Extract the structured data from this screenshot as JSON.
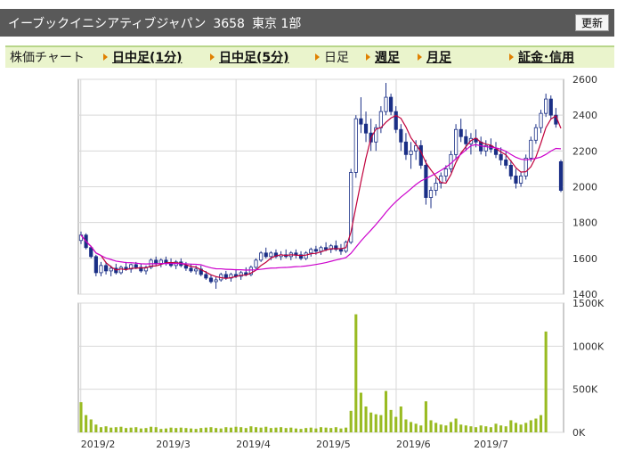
{
  "header": {
    "title": "イーブックイニシアティブジャパン",
    "code": "3658",
    "market": "東京 1部",
    "refresh_label": "更新"
  },
  "nav": {
    "chart_label": "株価チャート",
    "intraday_1": "日中足(1分)",
    "intraday_5": "日中足(5分)",
    "daily": "日足",
    "weekly": "週足",
    "monthly": "月足",
    "margin": "証金･信用"
  },
  "colors": {
    "up": "#ffffff",
    "down": "#1a2f86",
    "ma_short": "#c0003c",
    "ma_long": "#cc00cc",
    "volume": "#99bb22",
    "profile": "#999999"
  },
  "chart_data": [
    {
      "type": "candlestick",
      "y_ticks": [
        2600,
        2400,
        2200,
        2000,
        1800,
        1600,
        1400
      ],
      "ylim": [
        1400,
        2600
      ],
      "x_ticks": [
        "2019/2",
        "2019/3",
        "2019/4",
        "2019/5",
        "2019/6",
        "2019/7"
      ],
      "ohlc": [
        [
          1700,
          1750,
          1680,
          1730
        ],
        [
          1730,
          1740,
          1650,
          1660
        ],
        [
          1660,
          1670,
          1600,
          1610
        ],
        [
          1610,
          1620,
          1500,
          1520
        ],
        [
          1520,
          1580,
          1500,
          1560
        ],
        [
          1560,
          1580,
          1510,
          1530
        ],
        [
          1530,
          1560,
          1500,
          1545
        ],
        [
          1545,
          1570,
          1510,
          1520
        ],
        [
          1520,
          1560,
          1510,
          1550
        ],
        [
          1550,
          1580,
          1530,
          1540
        ],
        [
          1540,
          1570,
          1520,
          1565
        ],
        [
          1565,
          1580,
          1540,
          1550
        ],
        [
          1550,
          1570,
          1520,
          1530
        ],
        [
          1530,
          1560,
          1510,
          1550
        ],
        [
          1550,
          1600,
          1540,
          1590
        ],
        [
          1590,
          1610,
          1560,
          1570
        ],
        [
          1570,
          1600,
          1550,
          1590
        ],
        [
          1590,
          1610,
          1560,
          1575
        ],
        [
          1575,
          1600,
          1550,
          1560
        ],
        [
          1560,
          1590,
          1540,
          1580
        ],
        [
          1580,
          1600,
          1550,
          1560
        ],
        [
          1560,
          1580,
          1530,
          1545
        ],
        [
          1545,
          1570,
          1520,
          1530
        ],
        [
          1530,
          1560,
          1510,
          1540
        ],
        [
          1540,
          1560,
          1500,
          1510
        ],
        [
          1510,
          1530,
          1480,
          1490
        ],
        [
          1490,
          1510,
          1460,
          1470
        ],
        [
          1470,
          1500,
          1430,
          1480
        ],
        [
          1480,
          1520,
          1470,
          1510
        ],
        [
          1510,
          1530,
          1480,
          1490
        ],
        [
          1490,
          1520,
          1470,
          1510
        ],
        [
          1510,
          1540,
          1490,
          1500
        ],
        [
          1500,
          1530,
          1480,
          1520
        ],
        [
          1520,
          1550,
          1500,
          1510
        ],
        [
          1510,
          1560,
          1500,
          1550
        ],
        [
          1550,
          1600,
          1540,
          1590
        ],
        [
          1590,
          1640,
          1580,
          1630
        ],
        [
          1630,
          1660,
          1600,
          1610
        ],
        [
          1610,
          1640,
          1590,
          1630
        ],
        [
          1630,
          1650,
          1600,
          1610
        ],
        [
          1610,
          1640,
          1590,
          1620
        ],
        [
          1620,
          1650,
          1600,
          1610
        ],
        [
          1610,
          1640,
          1590,
          1630
        ],
        [
          1630,
          1650,
          1600,
          1620
        ],
        [
          1620,
          1640,
          1590,
          1600
        ],
        [
          1600,
          1640,
          1590,
          1630
        ],
        [
          1630,
          1660,
          1610,
          1650
        ],
        [
          1650,
          1670,
          1620,
          1640
        ],
        [
          1640,
          1670,
          1620,
          1660
        ],
        [
          1660,
          1690,
          1640,
          1650
        ],
        [
          1650,
          1680,
          1630,
          1670
        ],
        [
          1670,
          1700,
          1640,
          1650
        ],
        [
          1650,
          1680,
          1620,
          1640
        ],
        [
          1640,
          1700,
          1630,
          1690
        ],
        [
          1690,
          2100,
          1680,
          2080
        ],
        [
          2080,
          2400,
          2050,
          2380
        ],
        [
          2380,
          2500,
          2300,
          2350
        ],
        [
          2350,
          2420,
          2250,
          2300
        ],
        [
          2300,
          2380,
          2200,
          2250
        ],
        [
          2250,
          2350,
          2200,
          2330
        ],
        [
          2330,
          2450,
          2300,
          2420
        ],
        [
          2420,
          2580,
          2400,
          2500
        ],
        [
          2500,
          2520,
          2400,
          2420
        ],
        [
          2420,
          2450,
          2300,
          2320
        ],
        [
          2320,
          2350,
          2200,
          2250
        ],
        [
          2250,
          2300,
          2150,
          2180
        ],
        [
          2180,
          2250,
          2100,
          2200
        ],
        [
          2200,
          2260,
          2150,
          2230
        ],
        [
          2230,
          2260,
          2100,
          2120
        ],
        [
          2120,
          2150,
          1900,
          1940
        ],
        [
          1940,
          2000,
          1880,
          1980
        ],
        [
          1980,
          2050,
          1950,
          2020
        ],
        [
          2020,
          2080,
          1990,
          2060
        ],
        [
          2060,
          2120,
          2030,
          2100
        ],
        [
          2100,
          2200,
          2080,
          2180
        ],
        [
          2180,
          2350,
          2150,
          2320
        ],
        [
          2320,
          2380,
          2250,
          2280
        ],
        [
          2280,
          2320,
          2200,
          2240
        ],
        [
          2240,
          2300,
          2180,
          2270
        ],
        [
          2270,
          2320,
          2220,
          2250
        ],
        [
          2250,
          2280,
          2180,
          2200
        ],
        [
          2200,
          2260,
          2170,
          2230
        ],
        [
          2230,
          2270,
          2190,
          2210
        ],
        [
          2210,
          2250,
          2160,
          2180
        ],
        [
          2180,
          2220,
          2120,
          2150
        ],
        [
          2150,
          2200,
          2100,
          2120
        ],
        [
          2120,
          2150,
          2040,
          2060
        ],
        [
          2060,
          2100,
          1990,
          2020
        ],
        [
          2020,
          2080,
          2000,
          2060
        ],
        [
          2060,
          2180,
          2040,
          2160
        ],
        [
          2160,
          2280,
          2140,
          2260
        ],
        [
          2260,
          2350,
          2240,
          2330
        ],
        [
          2330,
          2430,
          2300,
          2410
        ],
        [
          2410,
          2520,
          2390,
          2490
        ],
        [
          2490,
          2510,
          2380,
          2400
        ],
        [
          2400,
          2440,
          2330,
          2350
        ],
        [
          2140,
          2150,
          1970,
          1980
        ]
      ]
    },
    {
      "type": "bar",
      "y_ticks": [
        "1500K",
        "1000K",
        "500K",
        "0K"
      ],
      "ylim": [
        0,
        1500000
      ],
      "values": [
        350000,
        200000,
        150000,
        90000,
        60000,
        70000,
        55000,
        60000,
        65000,
        50000,
        55000,
        60000,
        45000,
        50000,
        65000,
        60000,
        40000,
        45000,
        55000,
        50000,
        55000,
        50000,
        45000,
        40000,
        50000,
        55000,
        60000,
        50000,
        45000,
        60000,
        55000,
        65000,
        60000,
        50000,
        70000,
        60000,
        55000,
        65000,
        50000,
        55000,
        60000,
        50000,
        55000,
        45000,
        40000,
        50000,
        55000,
        45000,
        60000,
        55000,
        50000,
        60000,
        45000,
        55000,
        250000,
        1370000,
        460000,
        300000,
        230000,
        210000,
        200000,
        480000,
        260000,
        180000,
        300000,
        150000,
        120000,
        100000,
        80000,
        360000,
        140000,
        110000,
        90000,
        80000,
        120000,
        160000,
        90000,
        80000,
        70000,
        60000,
        80000,
        70000,
        60000,
        100000,
        80000,
        70000,
        140000,
        110000,
        90000,
        110000,
        140000,
        160000,
        200000,
        1170000
      ]
    }
  ]
}
